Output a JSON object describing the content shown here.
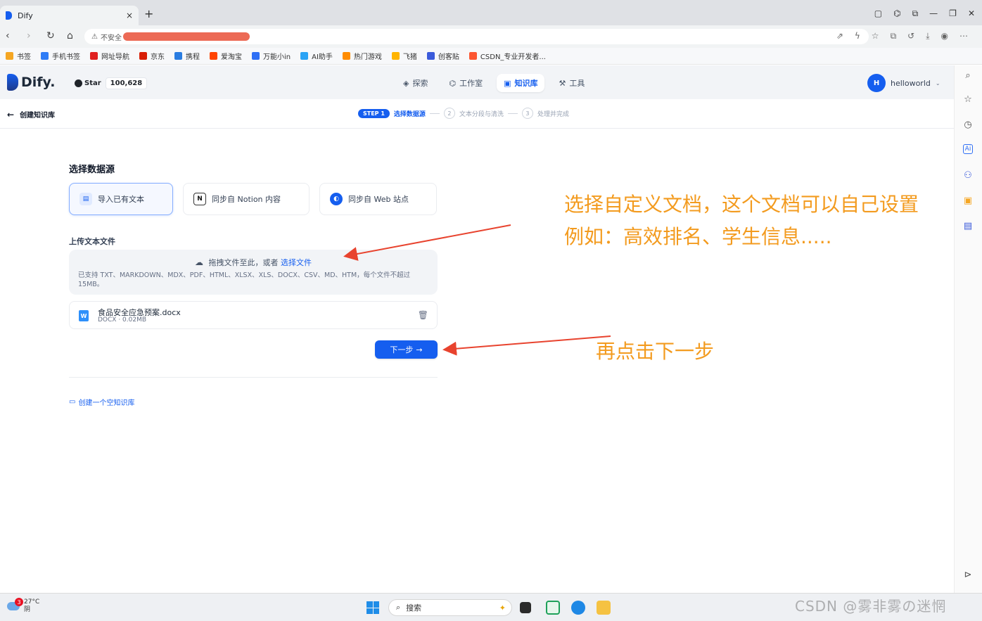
{
  "browser": {
    "tab_title": "Dify",
    "close_tab": "×",
    "new_tab": "+",
    "address_security": "不安全",
    "bookmarks": [
      {
        "label": "书签",
        "color": "#f5a623"
      },
      {
        "label": "手机书签",
        "color": "#2f7cf6"
      },
      {
        "label": "网址导航",
        "color": "#e02020"
      },
      {
        "label": "京东",
        "color": "#d81e06"
      },
      {
        "label": "携程",
        "color": "#2a7de1"
      },
      {
        "label": "爱淘宝",
        "color": "#ff4400"
      },
      {
        "label": "万能小in",
        "color": "#2f6ff5"
      },
      {
        "label": "AI助手",
        "color": "#2aa3f5"
      },
      {
        "label": "热门游戏",
        "color": "#ff8c00"
      },
      {
        "label": "飞猪",
        "color": "#ffb400"
      },
      {
        "label": "创客贴",
        "color": "#3b5bdb"
      },
      {
        "label": "CSDN_专业开发者...",
        "color": "#fc5531"
      }
    ]
  },
  "dify": {
    "logo_text": "Dify.",
    "github_star": "Star",
    "github_count": "100,628",
    "nav": [
      {
        "label": "探索",
        "icon": "compass-icon",
        "active": false
      },
      {
        "label": "工作室",
        "icon": "robot-icon",
        "active": false
      },
      {
        "label": "知识库",
        "icon": "book-icon",
        "active": true
      },
      {
        "label": "工具",
        "icon": "hammer-icon",
        "active": false
      }
    ],
    "user_initial": "H",
    "user_name": "helloworld",
    "back_label": "创建知识库",
    "steps": {
      "badge": "STEP 1",
      "step1": "选择数据源",
      "step2_num": "2",
      "step2": "文本分段与清洗",
      "step3_num": "3",
      "step3": "处理并完成"
    },
    "section_title": "选择数据源",
    "sources": [
      {
        "label": "导入已有文本",
        "active": true
      },
      {
        "label": "同步自 Notion 内容",
        "active": false
      },
      {
        "label": "同步自 Web 站点",
        "active": false
      }
    ],
    "upload_title": "上传文本文件",
    "dropzone": {
      "text": "拖拽文件至此，或者",
      "link": "选择文件",
      "tip": "已支持 TXT、MARKDOWN、MDX、PDF、HTML、XLSX、XLS、DOCX、CSV、MD、HTM，每个文件不超过 15MB。"
    },
    "file": {
      "name": "食品安全应急预案.docx",
      "meta": "DOCX · 0.02MB"
    },
    "next_button": "下一步",
    "empty_kb": "创建一个空知识库"
  },
  "annotations": {
    "line1": "选择自定义文档，这个文档可以自己设置",
    "line2": "例如：高效排名、学生信息.....",
    "next_hint": "再点击下一步",
    "arrow_color": "#e8432e",
    "text_color": "#f39b1f"
  },
  "taskbar": {
    "badge": "3",
    "temperature": "27°C",
    "weather": "阴",
    "search_placeholder": "搜索",
    "watermark": "CSDN @雾非雾の迷惘"
  }
}
